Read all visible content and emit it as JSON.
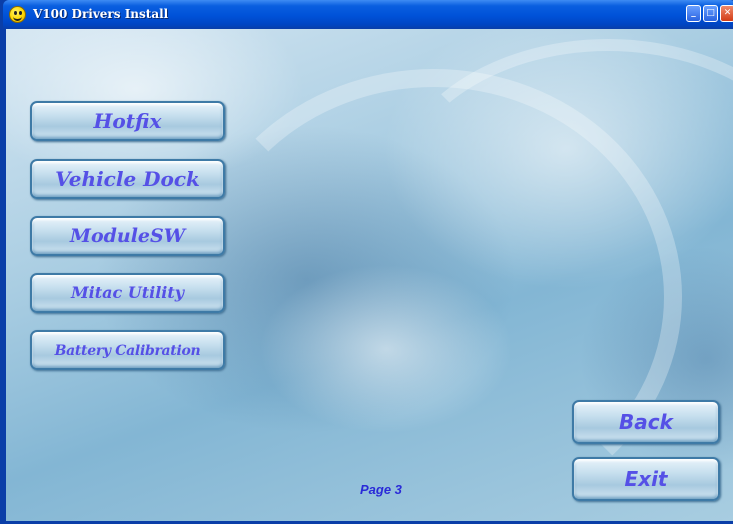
{
  "window": {
    "title": "V100 Drivers Install",
    "controls": {
      "minimize": "_",
      "maximize": "□",
      "close": "✕"
    },
    "colors": {
      "titlebar": "#0051d8",
      "accent_text": "#5550e6"
    }
  },
  "menu": {
    "items": [
      {
        "label": "Hotfix"
      },
      {
        "label": "Vehicle Dock"
      },
      {
        "label": "ModuleSW"
      },
      {
        "label": "Mitac Utility"
      },
      {
        "label": "Battery Calibration"
      }
    ]
  },
  "nav": {
    "back_label": "Back",
    "exit_label": "Exit"
  },
  "page_label": "Page 3",
  "icons": {
    "app": "smiley-icon"
  }
}
